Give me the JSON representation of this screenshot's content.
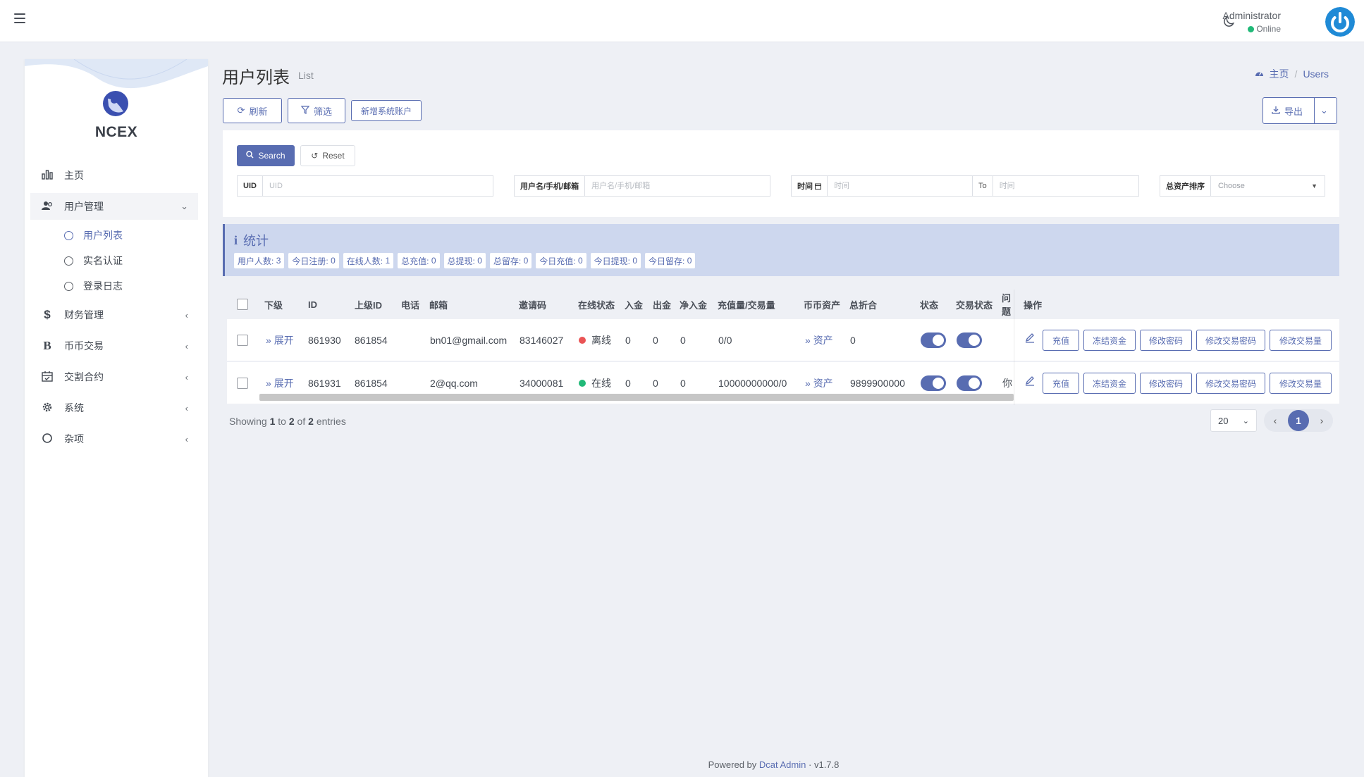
{
  "header": {
    "user_name": "Administrator",
    "user_status": "Online"
  },
  "sidebar": {
    "brand": "NCEX",
    "items": [
      {
        "label": "主页",
        "icon": "bar-chart-icon"
      },
      {
        "label": "用户管理",
        "icon": "users-icon"
      },
      {
        "label": "财务管理",
        "icon": "dollar-icon"
      },
      {
        "label": "币币交易",
        "icon": "bitcoin-icon"
      },
      {
        "label": "交割合约",
        "icon": "calendar-icon"
      },
      {
        "label": "系统",
        "icon": "gear-icon"
      },
      {
        "label": "杂项",
        "icon": "circle-icon"
      }
    ],
    "sub_items": [
      {
        "label": "用户列表",
        "active": true
      },
      {
        "label": "实名认证",
        "active": false
      },
      {
        "label": "登录日志",
        "active": false
      }
    ]
  },
  "page": {
    "title": "用户列表",
    "subtitle": "List",
    "breadcrumb": [
      "主页",
      "Users"
    ]
  },
  "toolbar": {
    "refresh": "刷新",
    "filter": "筛选",
    "add_system_account": "新增系统账户",
    "export": "导出"
  },
  "filters": {
    "search_button": "Search",
    "reset_button": "Reset",
    "uid_label": "UID",
    "uid_placeholder": "UID",
    "user_label": "用户名/手机/邮箱",
    "user_placeholder": "用户名/手机/邮箱",
    "time_label": "时间",
    "time_placeholder_from": "时间",
    "time_to": "To",
    "time_placeholder_to": "时间",
    "sort_label": "总资产排序",
    "sort_value": "Choose"
  },
  "stats": {
    "title": "统计",
    "items": [
      {
        "label": "用户人数:",
        "value": "3"
      },
      {
        "label": "今日注册:",
        "value": "0"
      },
      {
        "label": "在线人数:",
        "value": "1"
      },
      {
        "label": "总充值:",
        "value": "0"
      },
      {
        "label": "总提现:",
        "value": "0"
      },
      {
        "label": "总留存:",
        "value": "0"
      },
      {
        "label": "今日充值:",
        "value": "0"
      },
      {
        "label": "今日提现:",
        "value": "0"
      },
      {
        "label": "今日留存:",
        "value": "0"
      }
    ]
  },
  "table": {
    "columns": [
      "下级",
      "ID",
      "上级ID",
      "电话",
      "邮箱",
      "邀请码",
      "在线状态",
      "入金",
      "出金",
      "净入金",
      "充值量/交易量",
      "币币资产",
      "总折合",
      "状态",
      "交易状态",
      "问题",
      "操作"
    ],
    "rows": [
      {
        "expand": "展开",
        "id": "861930",
        "parent_id": "861854",
        "phone": "",
        "email": "bn01@gmail.com",
        "invite_code": "83146027",
        "online": "离线",
        "online_color": "#ea5455",
        "deposit": "0",
        "withdraw": "0",
        "net": "0",
        "volume": "0/0",
        "assets": "资产",
        "total": "0",
        "status_on": true,
        "trade_on": true,
        "question": ""
      },
      {
        "expand": "展开",
        "id": "861931",
        "parent_id": "861854",
        "phone": "",
        "email": "2@qq.com",
        "invite_code": "34000081",
        "online": "在线",
        "online_color": "#21b978",
        "deposit": "0",
        "withdraw": "0",
        "net": "0",
        "volume": "10000000000/0",
        "assets": "资产",
        "total": "9899900000",
        "status_on": true,
        "trade_on": true,
        "question": "你"
      }
    ],
    "actions": [
      "充值",
      "冻结资金",
      "修改密码",
      "修改交易密码",
      "修改交易量"
    ]
  },
  "pagination": {
    "showing_prefix": "Showing",
    "from": "1",
    "to_word": "to",
    "to": "2",
    "of_word": "of",
    "total": "2",
    "suffix": "entries",
    "per_page": "20",
    "current_page": "1"
  },
  "footer": {
    "powered_by": "Powered by",
    "link": "Dcat Admin",
    "separator": "·",
    "version": "v1.7.8"
  },
  "colors": {
    "primary": "#586cb1",
    "online": "#21b978",
    "offline": "#ea5455",
    "background": "#eef0f5"
  }
}
